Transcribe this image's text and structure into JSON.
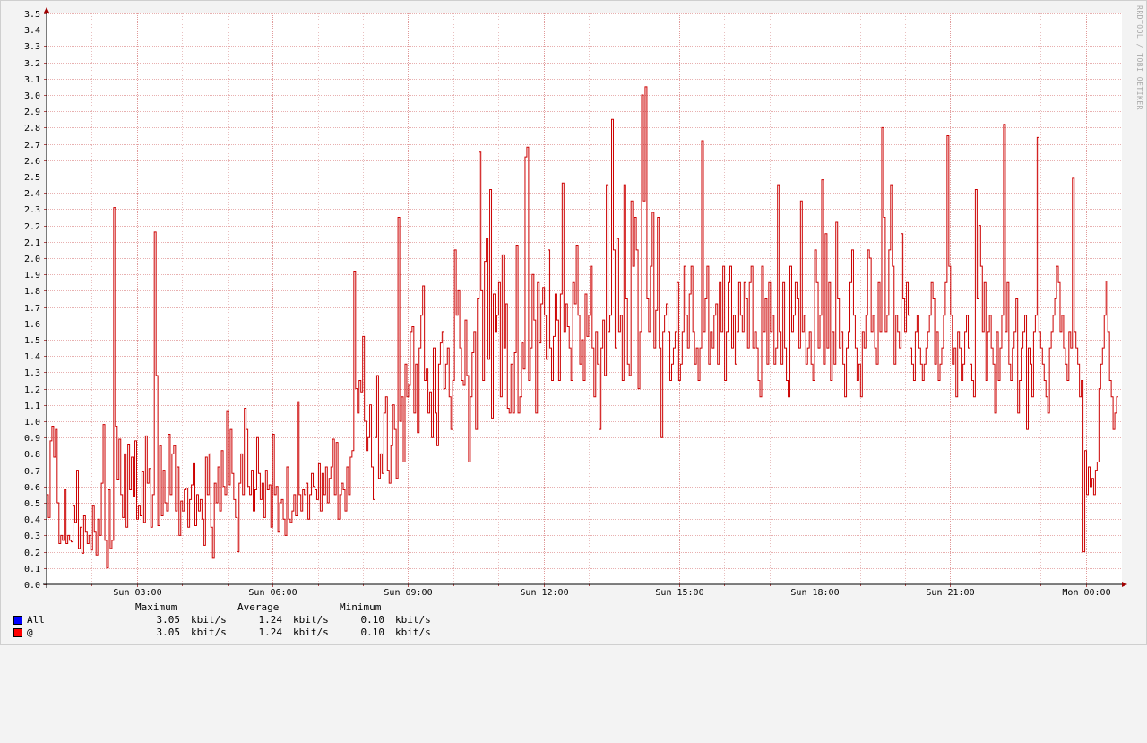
{
  "watermark": "RRDTOOL / TOBI OETIKER",
  "legend": {
    "headers": {
      "max": "Maximum",
      "avg": "Average",
      "min": "Minimum"
    },
    "items": [
      {
        "name": "All",
        "color": "#0000ff",
        "max": "3.05",
        "avg": "1.24",
        "min": "0.10",
        "unit": "kbit/s"
      },
      {
        "name": "@",
        "color": "#ff0000",
        "max": "3.05",
        "avg": "1.24",
        "min": "0.10",
        "unit": "kbit/s"
      }
    ]
  },
  "chart_data": {
    "type": "line",
    "step": true,
    "x_ticks": [
      "Sun 03:00",
      "Sun 06:00",
      "Sun 09:00",
      "Sun 12:00",
      "Sun 15:00",
      "Sun 18:00",
      "Sun 21:00",
      "Mon 00:00"
    ],
    "x_range_hours": [
      -2.0,
      21.8
    ],
    "ylim": [
      0,
      3.5
    ],
    "y_ticks": [
      "0.0",
      "0.1",
      "0.2",
      "0.3",
      "0.4",
      "0.5",
      "0.6",
      "0.7",
      "0.8",
      "0.9",
      "1.0",
      "1.1",
      "1.2",
      "1.3",
      "1.4",
      "1.5",
      "1.6",
      "1.7",
      "1.8",
      "1.9",
      "2.0",
      "2.1",
      "2.2",
      "2.3",
      "2.4",
      "2.5",
      "2.6",
      "2.7",
      "2.8",
      "2.9",
      "3.0",
      "3.1",
      "3.2",
      "3.3",
      "3.4",
      "3.5"
    ],
    "grid": true,
    "series": [
      {
        "name": "@",
        "color": "#cc0000",
        "values": [
          0.55,
          0.41,
          0.88,
          0.97,
          0.78,
          0.95,
          0.5,
          0.25,
          0.3,
          0.27,
          0.58,
          0.25,
          0.3,
          0.27,
          0.26,
          0.48,
          0.38,
          0.7,
          0.22,
          0.35,
          0.19,
          0.42,
          0.32,
          0.25,
          0.3,
          0.21,
          0.48,
          0.32,
          0.18,
          0.4,
          0.3,
          0.62,
          0.98,
          0.27,
          0.1,
          0.58,
          0.22,
          0.27,
          2.31,
          0.97,
          0.64,
          0.89,
          0.55,
          0.41,
          0.8,
          0.35,
          0.86,
          0.58,
          0.78,
          0.54,
          0.88,
          0.4,
          0.48,
          0.42,
          0.69,
          0.38,
          0.91,
          0.62,
          0.71,
          0.35,
          0.55,
          2.16,
          1.28,
          0.36,
          0.85,
          0.42,
          0.7,
          0.5,
          0.45,
          0.92,
          0.55,
          0.8,
          0.85,
          0.45,
          0.72,
          0.3,
          0.51,
          0.45,
          0.58,
          0.59,
          0.35,
          0.52,
          0.61,
          0.74,
          0.36,
          0.55,
          0.45,
          0.52,
          0.4,
          0.24,
          0.78,
          0.55,
          0.8,
          0.35,
          0.16,
          0.62,
          0.5,
          0.72,
          0.45,
          0.82,
          0.6,
          0.55,
          1.06,
          0.61,
          0.95,
          0.68,
          0.52,
          0.41,
          0.2,
          0.62,
          0.8,
          0.55,
          1.08,
          0.95,
          0.6,
          0.55,
          0.7,
          0.45,
          0.58,
          0.9,
          0.68,
          0.52,
          0.62,
          0.41,
          0.7,
          0.58,
          0.61,
          0.35,
          0.92,
          0.55,
          0.6,
          0.32,
          0.5,
          0.52,
          0.4,
          0.3,
          0.72,
          0.4,
          0.38,
          0.45,
          0.55,
          0.42,
          1.12,
          0.55,
          0.45,
          0.58,
          0.55,
          0.62,
          0.4,
          0.55,
          0.68,
          0.6,
          0.58,
          0.52,
          0.74,
          0.45,
          0.68,
          0.55,
          0.72,
          0.5,
          0.65,
          0.72,
          0.89,
          0.55,
          0.87,
          0.4,
          0.55,
          0.62,
          0.58,
          0.45,
          0.72,
          0.55,
          0.78,
          0.82,
          1.92,
          1.2,
          1.05,
          1.25,
          1.18,
          1.52,
          1.0,
          0.82,
          0.9,
          1.1,
          0.72,
          0.52,
          0.9,
          1.28,
          0.65,
          0.8,
          0.68,
          1.05,
          1.15,
          0.7,
          0.62,
          0.85,
          1.1,
          0.95,
          0.65,
          2.25,
          1.0,
          1.15,
          0.75,
          1.35,
          1.15,
          1.22,
          1.55,
          1.58,
          1.05,
          1.35,
          0.93,
          1.45,
          1.65,
          1.83,
          1.25,
          1.32,
          1.05,
          1.18,
          0.9,
          1.45,
          1.05,
          0.85,
          1.35,
          1.48,
          1.55,
          1.2,
          1.35,
          1.45,
          1.15,
          0.95,
          1.25,
          2.05,
          1.65,
          1.8,
          1.45,
          1.25,
          1.22,
          1.62,
          1.28,
          0.75,
          1.15,
          1.42,
          1.55,
          0.95,
          1.75,
          2.65,
          1.8,
          1.25,
          1.98,
          2.12,
          1.38,
          2.42,
          1.02,
          1.78,
          1.55,
          1.65,
          1.85,
          1.15,
          2.02,
          1.45,
          1.72,
          1.08,
          1.05,
          1.35,
          1.05,
          1.42,
          2.08,
          1.05,
          1.15,
          1.48,
          1.32,
          2.62,
          2.68,
          1.25,
          1.45,
          1.9,
          1.62,
          1.05,
          1.85,
          1.48,
          1.72,
          1.82,
          1.65,
          1.38,
          2.05,
          1.45,
          1.25,
          1.52,
          1.78,
          1.62,
          1.25,
          1.78,
          2.46,
          1.55,
          1.72,
          1.58,
          1.45,
          1.25,
          1.85,
          1.72,
          2.08,
          1.65,
          1.35,
          1.5,
          1.25,
          1.78,
          1.52,
          1.65,
          1.95,
          1.45,
          1.15,
          1.55,
          1.35,
          0.95,
          1.45,
          1.62,
          1.28,
          2.45,
          1.55,
          1.65,
          2.85,
          2.05,
          1.45,
          2.12,
          1.55,
          1.65,
          1.25,
          2.45,
          1.75,
          1.35,
          1.28,
          2.35,
          1.95,
          2.25,
          2.05,
          1.2,
          1.55,
          3.0,
          2.35,
          3.05,
          1.75,
          1.55,
          1.95,
          2.28,
          1.45,
          1.68,
          2.25,
          1.45,
          0.9,
          1.55,
          1.65,
          1.72,
          1.55,
          1.25,
          1.35,
          1.45,
          1.55,
          1.85,
          1.25,
          1.35,
          1.55,
          1.95,
          1.65,
          1.45,
          1.78,
          1.95,
          1.55,
          1.35,
          1.45,
          1.25,
          1.45,
          2.72,
          1.55,
          1.75,
          1.95,
          1.35,
          1.55,
          1.45,
          1.65,
          1.72,
          1.35,
          1.85,
          1.55,
          1.95,
          1.25,
          1.55,
          1.85,
          1.95,
          1.45,
          1.65,
          1.35,
          1.55,
          1.85,
          1.65,
          1.55,
          1.85,
          1.75,
          1.45,
          1.85,
          1.95,
          1.45,
          1.55,
          1.45,
          1.25,
          1.15,
          1.95,
          1.55,
          1.75,
          1.35,
          1.85,
          1.55,
          1.65,
          1.35,
          1.45,
          2.45,
          1.55,
          1.35,
          1.85,
          1.45,
          1.25,
          1.15,
          1.95,
          1.55,
          1.65,
          1.85,
          1.75,
          1.45,
          2.35,
          1.55,
          1.65,
          1.35,
          1.45,
          1.55,
          1.35,
          1.25,
          2.05,
          1.85,
          1.45,
          1.65,
          2.48,
          1.35,
          2.15,
          1.45,
          1.85,
          1.25,
          1.55,
          1.35,
          2.22,
          1.75,
          1.45,
          1.55,
          1.35,
          1.15,
          1.45,
          1.55,
          1.85,
          2.05,
          1.65,
          1.45,
          1.25,
          1.35,
          1.15,
          1.55,
          1.45,
          1.65,
          2.05,
          2.0,
          1.55,
          1.65,
          1.45,
          1.35,
          1.85,
          1.55,
          2.8,
          2.25,
          1.55,
          1.65,
          2.05,
          2.45,
          1.95,
          1.35,
          1.65,
          1.55,
          1.45,
          2.15,
          1.75,
          1.55,
          1.85,
          1.65,
          1.45,
          1.35,
          1.25,
          1.55,
          1.65,
          1.45,
          1.35,
          1.25,
          1.35,
          1.45,
          1.55,
          1.65,
          1.85,
          1.75,
          1.35,
          1.55,
          1.25,
          1.35,
          1.45,
          1.65,
          1.85,
          2.75,
          1.95,
          1.65,
          1.35,
          1.45,
          1.15,
          1.55,
          1.45,
          1.25,
          1.35,
          1.55,
          1.65,
          1.45,
          1.35,
          1.25,
          1.15,
          2.42,
          1.75,
          2.2,
          1.95,
          1.55,
          1.85,
          1.25,
          1.55,
          1.65,
          1.45,
          1.35,
          1.05,
          1.55,
          1.25,
          1.45,
          1.65,
          2.82,
          1.55,
          1.85,
          1.35,
          1.25,
          1.45,
          1.55,
          1.75,
          1.05,
          1.25,
          1.45,
          1.55,
          1.65,
          0.95,
          1.45,
          1.35,
          1.15,
          1.55,
          1.65,
          2.74,
          1.55,
          1.45,
          1.35,
          1.25,
          1.15,
          1.05,
          1.45,
          1.55,
          1.65,
          1.75,
          1.95,
          1.85,
          1.55,
          1.65,
          1.45,
          1.35,
          1.25,
          1.55,
          1.45,
          2.49,
          1.55,
          1.45,
          1.35,
          1.15,
          1.25,
          0.2,
          0.82,
          0.55,
          0.72,
          0.6,
          0.65,
          0.55,
          0.7,
          0.75,
          1.2,
          1.35,
          1.45,
          1.65,
          1.86,
          1.55,
          1.25,
          1.15,
          0.95,
          1.05,
          1.15
        ]
      }
    ]
  }
}
